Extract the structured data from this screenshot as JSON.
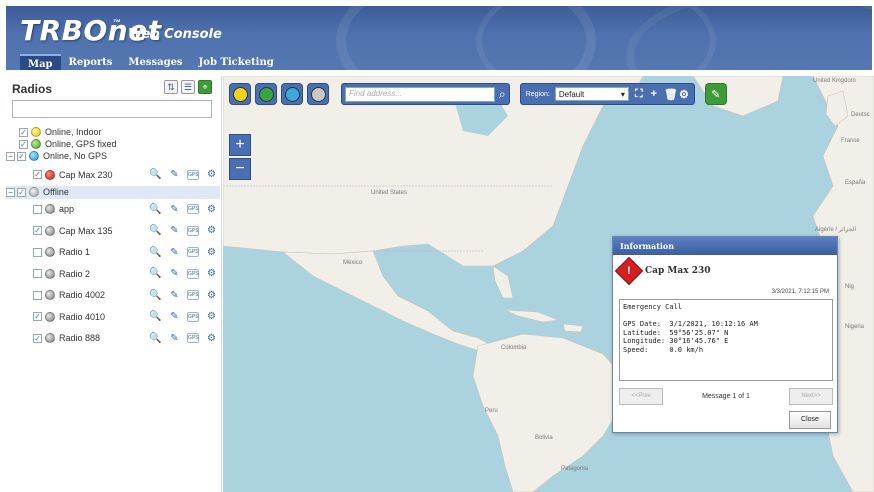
{
  "app": {
    "logo": "TRBOnet",
    "trademark": "™",
    "subtitle": "Web Console"
  },
  "menu": [
    {
      "label": "Map",
      "active": true
    },
    {
      "label": "Reports",
      "active": false
    },
    {
      "label": "Messages",
      "active": false
    },
    {
      "label": "Job Ticketing",
      "active": false
    }
  ],
  "sidebar": {
    "title": "Radios",
    "search_value": "",
    "legend": [
      {
        "label": "Online, Indoor",
        "color": "yellow"
      },
      {
        "label": "Online, GPS fixed",
        "color": "green"
      },
      {
        "label": "Online, No GPS",
        "color": "blue"
      }
    ],
    "online_radio": {
      "label": "Cap Max 230",
      "checked": true
    },
    "offline_group": {
      "label": "Offline",
      "checked": true
    },
    "offline_radios": [
      {
        "label": "app",
        "checked": false
      },
      {
        "label": "Cap Max 135",
        "checked": true
      },
      {
        "label": "Radio 1",
        "checked": false
      },
      {
        "label": "Radio 2",
        "checked": false
      },
      {
        "label": "Radio 4002",
        "checked": false
      },
      {
        "label": "Radio 4010",
        "checked": true
      },
      {
        "label": "Radio 888",
        "checked": true
      }
    ],
    "gps_label": "GPS"
  },
  "toolbar": {
    "address_placeholder": "Find address...",
    "region_label": "Region:",
    "region_value": "Default"
  },
  "map": {
    "labels": {
      "us": "United States",
      "mexico": "México",
      "colombia": "Colombia",
      "peru": "Peru",
      "bolivia": "Bolivia",
      "patagonia": "Patagonia",
      "france": "France",
      "espana": "España",
      "nigeria": "Nigeria",
      "algerie": "Algérie / الجزائر",
      "deutschland": "Deutsc",
      "uk": "United Kingdom",
      "niger": "Nig"
    }
  },
  "popup": {
    "title": "Information",
    "radio_name": "Cap Max 230",
    "timestamp": "3/3/2021, 7:12:15 PM",
    "message": "Emergency Call\n\nGPS Date:  3/1/2021, 10:12:16 AM\nLatitude:  59°56'25.07\" N\nLongitude: 30°16'45.76\" E\nSpeed:     0.0 km/h",
    "prev_label": "<<Prev",
    "next_label": "Next>>",
    "counter": "Message 1 of 1",
    "close_label": "Close"
  },
  "colors": {
    "header": "#4a6dab",
    "water": "#aad3df",
    "land": "#f2efe9",
    "accent_green": "#3f9a3a",
    "emergency": "#d42020"
  }
}
